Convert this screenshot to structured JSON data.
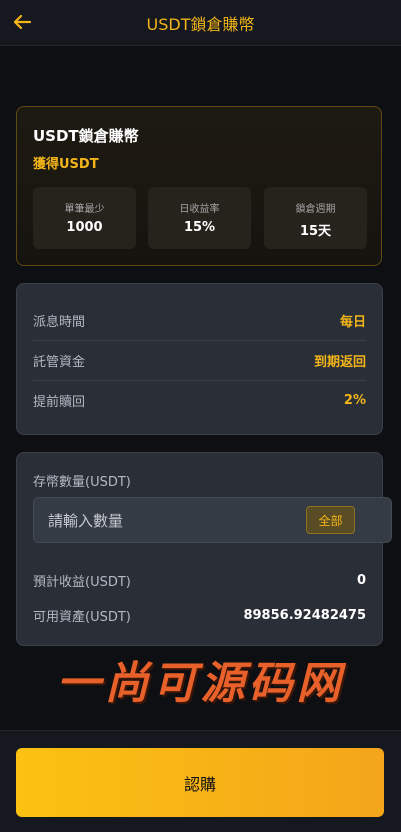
{
  "header": {
    "title": "USDT鎖倉賺幣",
    "back_icon": "arrow-left-icon"
  },
  "product": {
    "title": "USDT鎖倉賺幣",
    "subtitle": "獲得USDT",
    "stats": [
      {
        "label": "單筆最少",
        "value": "1000"
      },
      {
        "label": "日收益率",
        "value": "15%"
      },
      {
        "label": "鎖倉週期",
        "value": "15天"
      }
    ]
  },
  "terms": [
    {
      "label": "派息時間",
      "value": "每日"
    },
    {
      "label": "託管資金",
      "value": "到期返回"
    },
    {
      "label": "提前贖回",
      "value": "2%"
    }
  ],
  "deposit": {
    "label": "存幣數量(USDT)",
    "placeholder": "請輸入數量",
    "all_button": "全部",
    "expected_label": "預計收益(USDT)",
    "expected_value": "0",
    "available_label": "可用資產(USDT)",
    "available_value": "89856.92482475"
  },
  "watermark": "一尚可源码网",
  "confirm_button": "認購",
  "colors": {
    "accent": "#f3b519",
    "background": "#0d0f13",
    "panel": "#2a2f37"
  }
}
